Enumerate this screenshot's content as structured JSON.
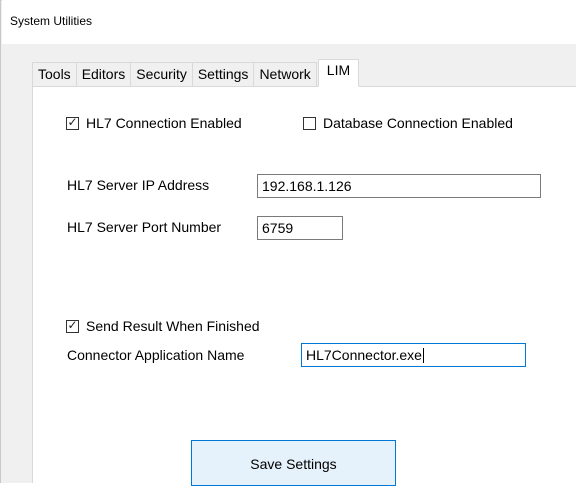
{
  "window": {
    "title": "System Utilities"
  },
  "tabs": [
    {
      "label": "Tools"
    },
    {
      "label": "Editors"
    },
    {
      "label": "Security"
    },
    {
      "label": "Settings"
    },
    {
      "label": "Network"
    },
    {
      "label": "LIM",
      "active": true
    }
  ],
  "lim": {
    "hl7_enabled": {
      "label": "HL7 Connection Enabled",
      "checked": true
    },
    "db_enabled": {
      "label": "Database Connection Enabled",
      "checked": false
    },
    "server_ip": {
      "label": "HL7 Server IP Address",
      "value": "192.168.1.126"
    },
    "server_port": {
      "label": "HL7 Server Port Number",
      "value": "6759"
    },
    "send_result": {
      "label": "Send Result When Finished",
      "checked": true
    },
    "connector_app": {
      "label": "Connector Application Name",
      "value": "HL7Connector.exe"
    },
    "save_label": "Save Settings"
  },
  "colors": {
    "focus_border": "#0078d7",
    "button_bg": "#e5f1fb",
    "panel_bg": "#ffffff",
    "window_bg": "#f0f0f0"
  }
}
